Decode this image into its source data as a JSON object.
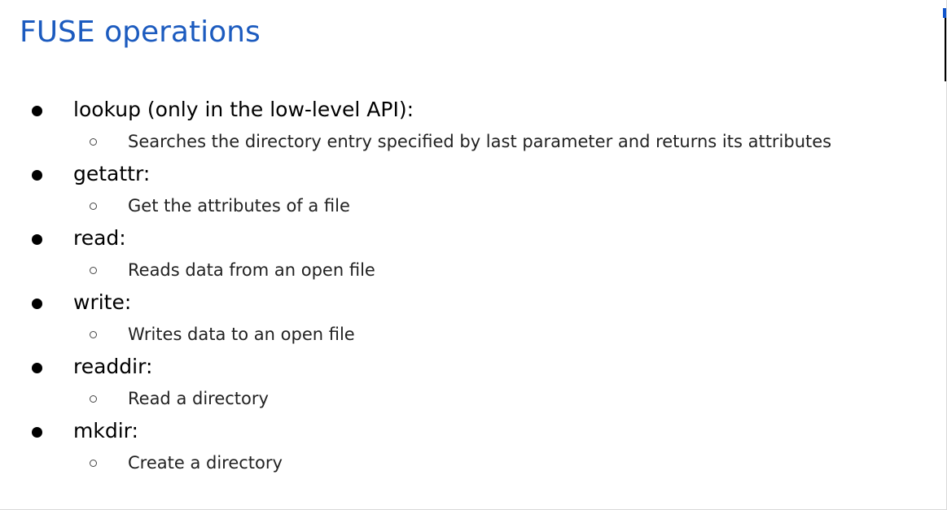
{
  "slide": {
    "title": "FUSE operations",
    "items": [
      {
        "label": "lookup (only in the low-level API):",
        "sub": "Searches the directory entry specified by last parameter and returns its attributes"
      },
      {
        "label": "getattr:",
        "sub": "Get the attributes of a file"
      },
      {
        "label": "read:",
        "sub": "Reads data from an open file"
      },
      {
        "label": "write:",
        "sub": "Writes data to an open file"
      },
      {
        "label": "readdir:",
        "sub": "Read a directory"
      },
      {
        "label": "mkdir:",
        "sub": "Create a directory"
      }
    ]
  },
  "colors": {
    "title": "#1c5bbf",
    "text": "#000000",
    "accent_marker": "#1155cc"
  }
}
